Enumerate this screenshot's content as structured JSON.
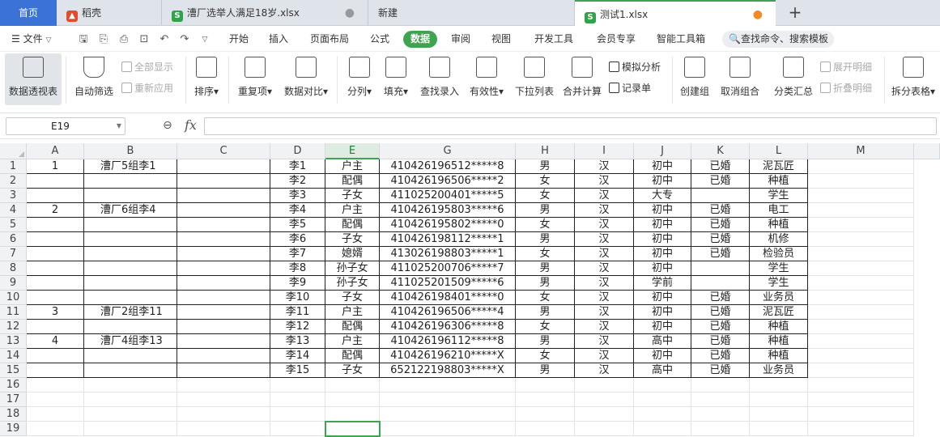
{
  "tabs": [
    {
      "label": "首页",
      "type": "home"
    },
    {
      "label": "稻壳",
      "icon": "docer-icon"
    },
    {
      "label": "漕厂选举人满足18岁.xlsx",
      "icon": "sheet-icon",
      "dot": "●"
    },
    {
      "label": "新建"
    },
    {
      "label": "测试1.xlsx",
      "icon": "sheet-icon",
      "dot": "●",
      "active": true
    }
  ],
  "add_tab": "+",
  "menubar": {
    "file_label": "文件",
    "items": [
      "开始",
      "插入",
      "页面布局",
      "公式",
      "数据",
      "审阅",
      "视图",
      "开发工具",
      "会员专享",
      "智能工具箱"
    ],
    "active": "数据",
    "search_placeholder": "查找命令、搜索模板"
  },
  "ribbon": {
    "pivot": "数据透视表",
    "autofilter": "自动筛选",
    "show_all": "全部显示",
    "reapply": "重新应用",
    "sort": "排序",
    "duplicates": "重复项",
    "compare": "数据对比",
    "split_col": "分列",
    "fill": "填充",
    "lookup": "查找录入",
    "validity": "有效性",
    "dropdown": "下拉列表",
    "consolidate": "合并计算",
    "simulate": "模拟分析",
    "record": "记录单",
    "create_group": "创建组",
    "ungroup": "取消组合",
    "subtotal": "分类汇总",
    "expand_detail": "展开明细",
    "collapse_detail": "折叠明细",
    "split_table": "拆分表格"
  },
  "formula_bar": {
    "name_box": "E19",
    "fx": "fx",
    "value": ""
  },
  "columns": [
    "A",
    "B",
    "C",
    "D",
    "E",
    "G",
    "H",
    "I",
    "J",
    "K",
    "L",
    "M"
  ],
  "selected_column": "E",
  "rows": [
    {
      "num": "1",
      "A": "1",
      "B": "漕厂5组李1",
      "D": "李1",
      "E": "户主",
      "G": "410426196512*****8",
      "H": "男",
      "I": "汉",
      "J": "初中",
      "K": "已婚",
      "L": "泥瓦匠"
    },
    {
      "num": "2",
      "A": "",
      "B": "",
      "D": "李2",
      "E": "配偶",
      "G": "410426196506*****2",
      "H": "女",
      "I": "汉",
      "J": "初中",
      "K": "已婚",
      "L": "种植"
    },
    {
      "num": "3",
      "A": "",
      "B": "",
      "D": "李3",
      "E": "子女",
      "G": "411025200401*****5",
      "H": "女",
      "I": "汉",
      "J": "大专",
      "K": "",
      "L": "学生"
    },
    {
      "num": "4",
      "A": "2",
      "B": "漕厂6组李4",
      "D": "李4",
      "E": "户主",
      "G": "410426195803*****6",
      "H": "男",
      "I": "汉",
      "J": "初中",
      "K": "已婚",
      "L": "电工"
    },
    {
      "num": "5",
      "A": "",
      "B": "",
      "D": "李5",
      "E": "配偶",
      "G": "410426195802*****0",
      "H": "女",
      "I": "汉",
      "J": "初中",
      "K": "已婚",
      "L": "种植"
    },
    {
      "num": "6",
      "A": "",
      "B": "",
      "D": "李6",
      "E": "子女",
      "G": "410426198112*****1",
      "H": "男",
      "I": "汉",
      "J": "初中",
      "K": "已婚",
      "L": "机修"
    },
    {
      "num": "7",
      "A": "",
      "B": "",
      "D": "李7",
      "E": "媳婿",
      "G": "413026198803*****1",
      "H": "女",
      "I": "汉",
      "J": "初中",
      "K": "已婚",
      "L": "检验员"
    },
    {
      "num": "8",
      "A": "",
      "B": "",
      "D": "李8",
      "E": "孙子女",
      "G": "411025200706*****7",
      "H": "男",
      "I": "汉",
      "J": "初中",
      "K": "",
      "L": "学生"
    },
    {
      "num": "9",
      "A": "",
      "B": "",
      "D": "李9",
      "E": "孙子女",
      "G": "411025201509*****6",
      "H": "男",
      "I": "汉",
      "J": "学前",
      "K": "",
      "L": "学生"
    },
    {
      "num": "10",
      "A": "",
      "B": "",
      "D": "李10",
      "E": "子女",
      "G": "410426198401*****0",
      "H": "女",
      "I": "汉",
      "J": "初中",
      "K": "已婚",
      "L": "业务员"
    },
    {
      "num": "11",
      "A": "3",
      "B": "漕厂2组李11",
      "D": "李11",
      "E": "户主",
      "G": "410426196506*****4",
      "H": "男",
      "I": "汉",
      "J": "初中",
      "K": "已婚",
      "L": "泥瓦匠"
    },
    {
      "num": "12",
      "A": "",
      "B": "",
      "D": "李12",
      "E": "配偶",
      "G": "410426196306*****8",
      "H": "女",
      "I": "汉",
      "J": "初中",
      "K": "已婚",
      "L": "种植"
    },
    {
      "num": "13",
      "A": "4",
      "B": "漕厂4组李13",
      "D": "李13",
      "E": "户主",
      "G": "410426196112*****8",
      "H": "男",
      "I": "汉",
      "J": "高中",
      "K": "已婚",
      "L": "种植"
    },
    {
      "num": "14",
      "A": "",
      "B": "",
      "D": "李14",
      "E": "配偶",
      "G": "410426196210*****X",
      "H": "女",
      "I": "汉",
      "J": "初中",
      "K": "已婚",
      "L": "种植"
    },
    {
      "num": "15",
      "A": "",
      "B": "",
      "D": "李15",
      "E": "子女",
      "G": "652122198803*****X",
      "H": "男",
      "I": "汉",
      "J": "高中",
      "K": "已婚",
      "L": "业务员"
    },
    {
      "num": "16"
    },
    {
      "num": "17"
    },
    {
      "num": "18"
    },
    {
      "num": "19"
    }
  ],
  "accent_color": "#3fa44f",
  "home_tab_color": "#3a72d8"
}
